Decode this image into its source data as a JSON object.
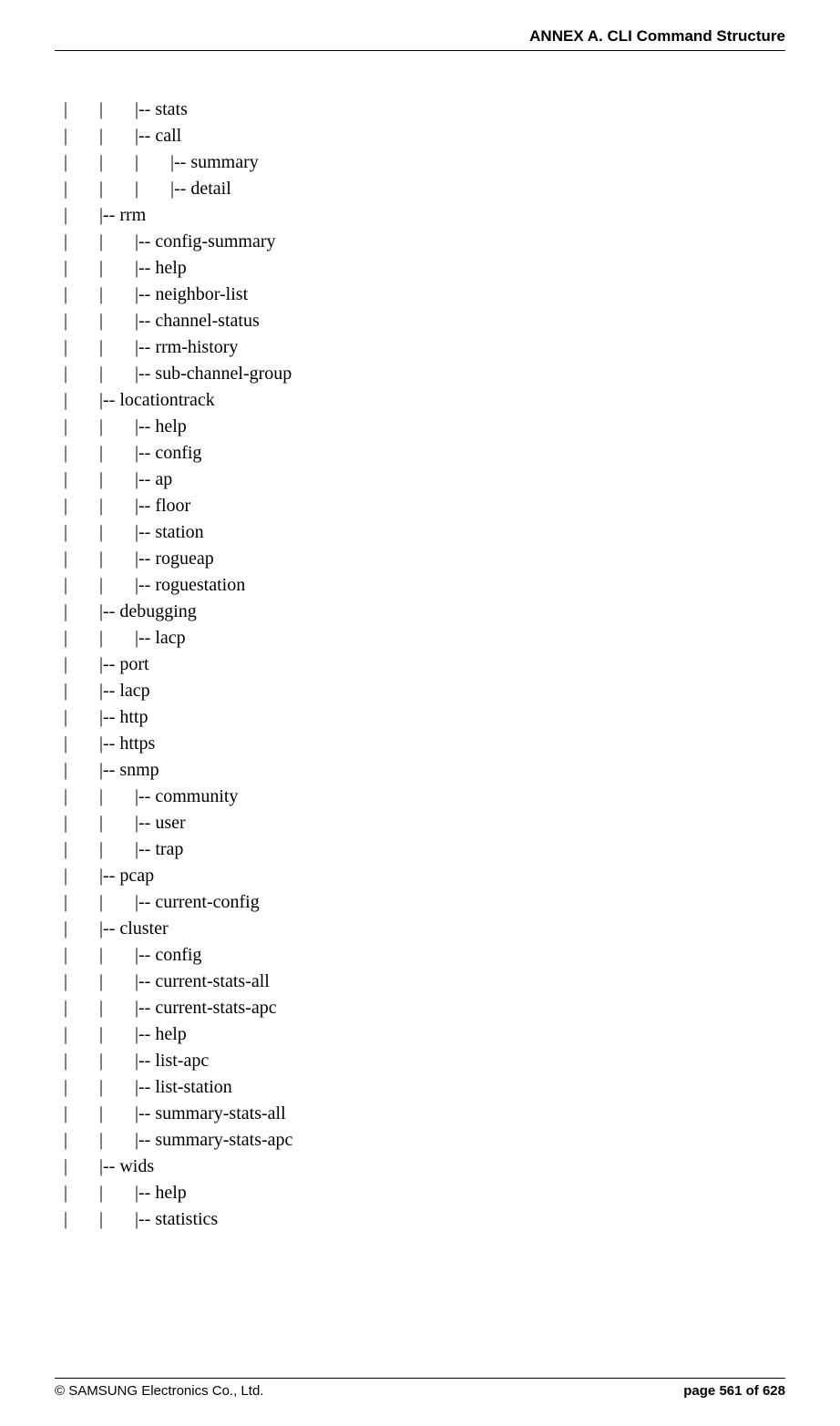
{
  "header": {
    "title": "ANNEX A. CLI Command Structure"
  },
  "tree_lines": [
    "|       |       |-- stats",
    "|       |       |-- call",
    "|       |       |       |-- summary",
    "|       |       |       |-- detail",
    "|       |-- rrm",
    "|       |       |-- config-summary",
    "|       |       |-- help",
    "|       |       |-- neighbor-list",
    "|       |       |-- channel-status",
    "|       |       |-- rrm-history",
    "|       |       |-- sub-channel-group",
    "|       |-- locationtrack",
    "|       |       |-- help",
    "|       |       |-- config",
    "|       |       |-- ap",
    "|       |       |-- floor",
    "|       |       |-- station",
    "|       |       |-- rogueap",
    "|       |       |-- roguestation",
    "|       |-- debugging",
    "|       |       |-- lacp",
    "|       |-- port",
    "|       |-- lacp",
    "|       |-- http",
    "|       |-- https",
    "|       |-- snmp",
    "|       |       |-- community",
    "|       |       |-- user",
    "|       |       |-- trap",
    "|       |-- pcap",
    "|       |       |-- current-config",
    "|       |-- cluster",
    "|       |       |-- config",
    "|       |       |-- current-stats-all",
    "|       |       |-- current-stats-apc",
    "|       |       |-- help",
    "|       |       |-- list-apc",
    "|       |       |-- list-station",
    "|       |       |-- summary-stats-all",
    "|       |       |-- summary-stats-apc",
    "|       |-- wids",
    "|       |       |-- help",
    "|       |       |-- statistics"
  ],
  "footer": {
    "copyright": "© SAMSUNG Electronics Co., Ltd.",
    "page_info": "page 561 of 628"
  }
}
